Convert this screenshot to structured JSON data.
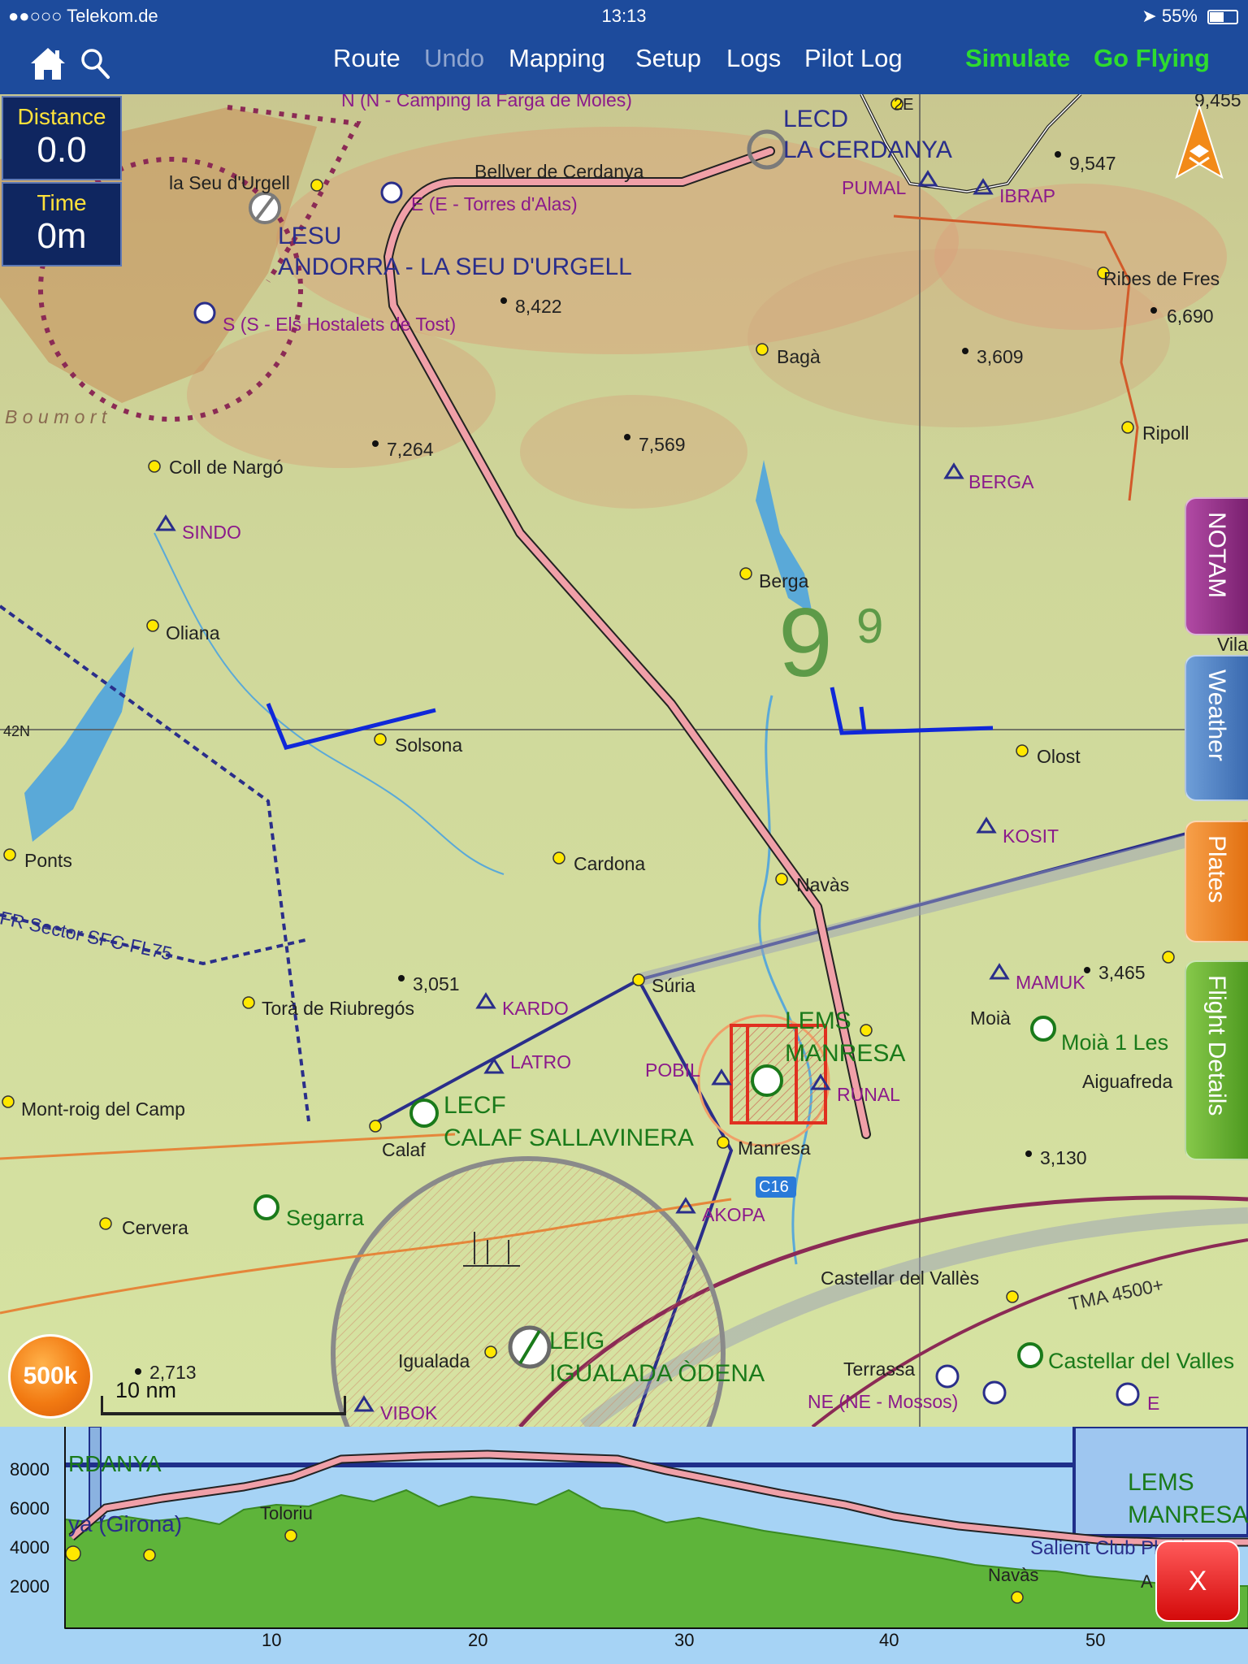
{
  "status_bar": {
    "carrier": "●●○○○ Telekom.de",
    "time": "13:13",
    "battery": "55%"
  },
  "nav": {
    "route": "Route",
    "undo": "Undo",
    "mapping": "Mapping",
    "setup": "Setup",
    "logs": "Logs",
    "pilot_log": "Pilot Log",
    "simulate": "Simulate",
    "go_flying": "Go Flying"
  },
  "info": {
    "distance_label": "Distance",
    "distance_value": "0.0",
    "time_label": "Time",
    "time_value": "0m"
  },
  "side_tabs": {
    "notam": "NOTAM",
    "weather": "Weather",
    "plates": "Plates",
    "flight_details": "Flight Details"
  },
  "map": {
    "zoom_label": "500k",
    "scale_label": "10 nm",
    "grid_label": "42N",
    "airports": {
      "lecd_code": "LECD",
      "lecd_name": "LA CERDANYA",
      "lesu_code": "LESU",
      "lesu_name": "ANDORRA - LA SEU D'URGELL",
      "lems_code": "LEMS",
      "lems_name": "MANRESA",
      "lecf_code": "LECF",
      "lecf_name": "CALAF SALLAVINERA",
      "leig_code": "LEIG",
      "leig_name": "IGUALADA ÒDENA"
    },
    "towns": {
      "la_seu": "la Seu d'Urgell",
      "bellver": "Bellver de Cerdanya",
      "coll_de_nargo": "Coll de Nargó",
      "oliana": "Oliana",
      "solsona": "Solsona",
      "ponts": "Ponts",
      "cardona": "Cardona",
      "bagà": "Bagà",
      "berga": "Berga",
      "ripoll": "Ripoll",
      "ribes": "Ribes de Fres",
      "olost": "Olost",
      "navas": "Navàs",
      "suria": "Súria",
      "tora": "Torà de Riubregós",
      "mont_roig": "Mont-roig del Camp",
      "calaf": "Calaf",
      "manresa": "Manresa",
      "cervera": "Cervera",
      "segarra": "Segarra",
      "moia": "Moià",
      "moia_les": "Moià 1 Les",
      "aiguafreda": "Aiguafreda",
      "castellar": "Castellar del Vallès",
      "castellar_vallès": "Castellar del Valles",
      "terrassa": "Terrassa",
      "igualada": "Igualada",
      "vila": "Vila"
    },
    "waypoints": {
      "pumal": "PUMAL",
      "ibrap": "IBRAP",
      "sindo": "SINDO",
      "berga": "BERGA",
      "kosit": "KOSIT",
      "kardo": "KARDO",
      "latro": "LATRO",
      "pobil": "POBIL",
      "runal": "RUNAL",
      "mamuk": "MAMUK",
      "akopa": "AKOPA",
      "vibok": "VIBOK"
    },
    "vfr": {
      "n": "N (N - Camping la Farga de Moles)",
      "e": "E (E - Torres d'Alas)",
      "s": "S (S - Els Hostalets de Tost)",
      "ne": "NE (NE - Mossos)",
      "e2": "E"
    },
    "elevations": {
      "e8422": "8,422",
      "e7264": "7,264",
      "e7569": "7,569",
      "e9547": "9,547",
      "e9455": "9,455",
      "e3609": "3,609",
      "e6690": "6,690",
      "e3051": "3,051",
      "e3465": "3,465",
      "e3130": "3,130",
      "e2713": "2,713"
    },
    "misc": {
      "sector": "FR Sector SFC-FL75",
      "tma": "TMA 4500+",
      "c16": "C16",
      "twoE": "2E",
      "grid_big": "9",
      "grid_small": "9",
      "boumort": "B o u m o r t"
    }
  },
  "profile": {
    "y_ticks": [
      "8000",
      "6000",
      "4000",
      "2000"
    ],
    "x_ticks": [
      "10",
      "20",
      "30",
      "40",
      "50"
    ],
    "labels": {
      "cerdanya": "RDANYA",
      "girona": "ya (Girona)",
      "toloriu": "Toloriu",
      "lems": "LEMS",
      "manresa": "MANRESA",
      "salient": "Salient Club Pla de B",
      "navas": "Navàs",
      "a": "A"
    },
    "close_label": "X"
  },
  "colors": {
    "nav_bg": "#1d4b9c",
    "route": "#f0a0a8",
    "go_green": "#2edc2e"
  }
}
